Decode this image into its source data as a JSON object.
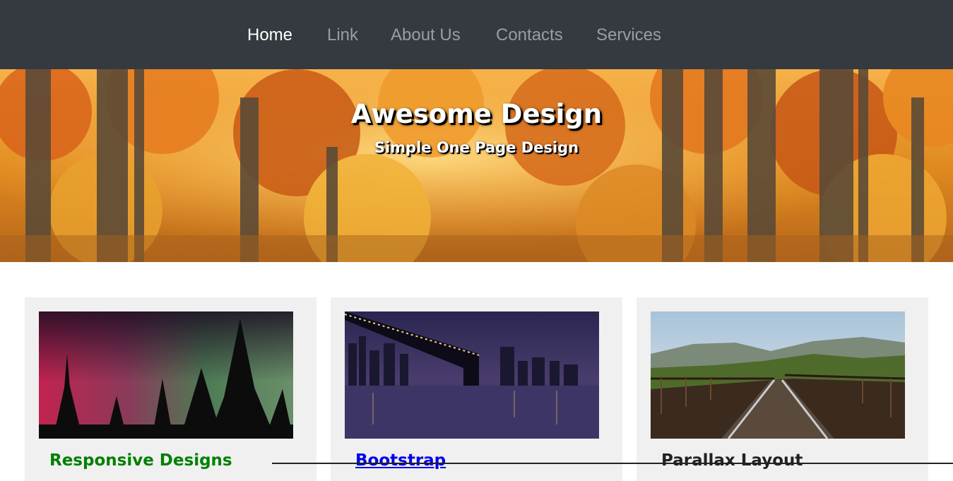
{
  "navbar": {
    "background": "#343a40",
    "items": [
      {
        "label": "Home",
        "active": true
      },
      {
        "label": "Link",
        "active": false
      },
      {
        "label": "About Us",
        "active": false
      },
      {
        "label": "Contacts",
        "active": false
      },
      {
        "label": "Services",
        "active": false
      }
    ]
  },
  "hero": {
    "title": "Awesome Design",
    "subtitle": "Simple One Page Design",
    "image": "autumn forest"
  },
  "cards": [
    {
      "title": "Responsive Designs",
      "color": "#008000",
      "image": "aurora over pine trees"
    },
    {
      "title": "Bootstrap",
      "color": "#0000ee",
      "image": "city bridge at night"
    },
    {
      "title": "Parallax Layout",
      "color": "#222222",
      "image": "railway bridge and hills"
    }
  ]
}
